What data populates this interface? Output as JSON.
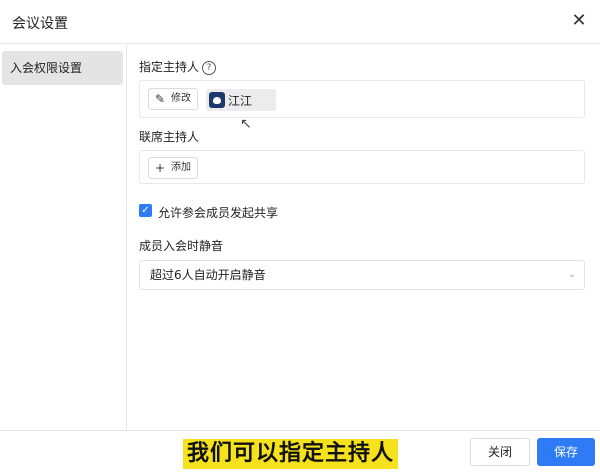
{
  "dialog": {
    "title": "会议设置"
  },
  "sidebar": {
    "items": [
      {
        "label": "入会权限设置"
      }
    ]
  },
  "host": {
    "label": "指定主持人",
    "help_icon": "?",
    "edit_label": "修改",
    "name": "江江"
  },
  "cohost": {
    "label": "联席主持人",
    "add_label": "添加"
  },
  "share": {
    "checked": true,
    "label": "允许参会成员发起共享"
  },
  "mute": {
    "label": "成员入会时静音",
    "selected": "超过6人自动开启静音"
  },
  "footer": {
    "caption": "我们可以指定主持人",
    "close_label": "关闭",
    "save_label": "保存"
  },
  "colors": {
    "accent": "#2f7bf5",
    "caption_bg": "#f5e21c"
  }
}
